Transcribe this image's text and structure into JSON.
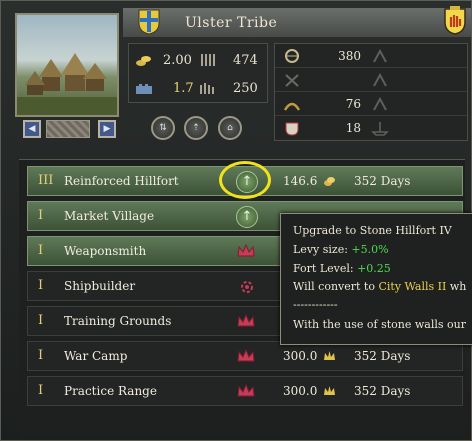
{
  "header": {
    "title": "Ulster Tribe",
    "colors": {
      "title_bar": "#5c605c",
      "blue_cross_shield": "#2f6fbe",
      "red_hand_shield": "#c23a1e"
    }
  },
  "stats": {
    "gold": "2.00",
    "levy": "474",
    "tech": "1.7",
    "garrison": "250"
  },
  "military": {
    "rows": [
      {
        "icon": "archer-icon",
        "value": "380"
      },
      {
        "icon": "crossed-swords-icon",
        "value": ""
      },
      {
        "icon": "horse-archer-icon",
        "value": "76"
      },
      {
        "icon": "knight-icon",
        "value": "18"
      }
    ]
  },
  "buildings": [
    {
      "level": "III",
      "name": "Reinforced Hillfort",
      "icon": "upgrade-arrow-icon",
      "cost": "146.6",
      "cost_icon": "coin-icon",
      "time": "352 Days",
      "highlighted": true
    },
    {
      "level": "I",
      "name": "Market Village",
      "icon": "upgrade-arrow-icon",
      "cost": "",
      "time": "",
      "highlighted": true
    },
    {
      "level": "I",
      "name": "Weaponsmith",
      "icon": "crown-icon",
      "cost": "",
      "time": "",
      "highlighted": true
    },
    {
      "level": "I",
      "name": "Shipbuilder",
      "icon": "gear-icon",
      "cost": "",
      "time": "",
      "highlighted": false
    },
    {
      "level": "I",
      "name": "Training Grounds",
      "icon": "crown-icon",
      "cost": "",
      "time": "",
      "highlighted": false
    },
    {
      "level": "I",
      "name": "War Camp",
      "icon": "crown-icon",
      "cost": "300.0",
      "cost_icon": "crown-icon",
      "time": "352 Days",
      "highlighted": false
    },
    {
      "level": "I",
      "name": "Practice Range",
      "icon": "crown-icon",
      "cost": "300.0",
      "cost_icon": "crown-icon",
      "time": "352 Days",
      "highlighted": false
    }
  ],
  "tooltip": {
    "title": "Upgrade to Stone Hillfort IV",
    "levy_label": "Levy size: ",
    "levy_value": "+5.0%",
    "fort_label": "Fort Level: ",
    "fort_value": "+0.25",
    "convert_label": "Will convert to ",
    "convert_target": "City Walls II",
    "convert_tail": " wh",
    "separator": "------------",
    "footer": "With the use of stone walls our"
  }
}
